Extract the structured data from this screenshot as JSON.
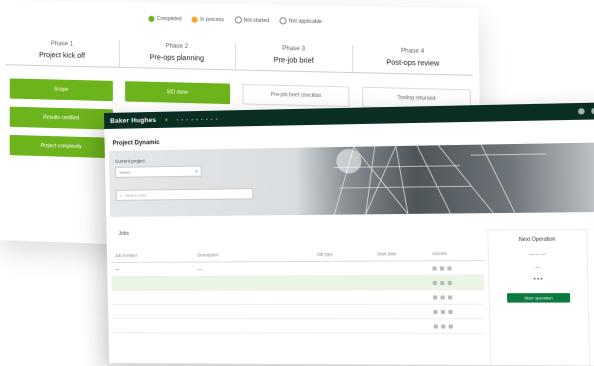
{
  "legend": {
    "completed": "Completed",
    "in_process": "In process",
    "not_started": "Not started",
    "not_applicable": "Not applicable"
  },
  "phases": [
    {
      "number": "Phase 1",
      "name": "Project kick off"
    },
    {
      "number": "Phase 2",
      "name": "Pre-ops planning"
    },
    {
      "number": "Phase 3",
      "name": "Pre-job brief"
    },
    {
      "number": "Phase 4",
      "name": "Post-ops review"
    }
  ],
  "tasks": [
    {
      "label": "Scope",
      "status": "completed"
    },
    {
      "label": "SID done",
      "status": "completed"
    },
    {
      "label": "Pre-job brief checklist",
      "status": "notstarted"
    },
    {
      "label": "Tooling returned",
      "status": "notstarted"
    },
    {
      "label": "Results certified",
      "status": "completed"
    },
    {
      "label": "",
      "status": "empty"
    },
    {
      "label": "",
      "status": "completed"
    },
    {
      "label": "",
      "status": "completed"
    },
    {
      "label": "Project complexity",
      "status": "completed"
    }
  ],
  "app": {
    "brand": "Baker Hughes",
    "page_title": "Project Dynamic",
    "hero_label": "Current project",
    "select_placeholder": "Select",
    "search_placeholder": "Search jobs",
    "jobs_title": "Jobs",
    "table_headers": [
      "Job number",
      "Description",
      "Job type",
      "Start date",
      "Actions"
    ],
    "rows": [
      {
        "c1": "—",
        "c2": "—",
        "c3": "",
        "c4": "",
        "highlight": false
      },
      {
        "c1": "",
        "c2": "",
        "c3": "",
        "c4": "",
        "highlight": true
      },
      {
        "c1": "",
        "c2": "",
        "c3": "",
        "c4": "",
        "highlight": false
      },
      {
        "c1": "",
        "c2": "",
        "c3": "",
        "c4": "",
        "highlight": false
      },
      {
        "c1": "",
        "c2": "",
        "c3": "",
        "c4": "",
        "highlight": false
      }
    ],
    "side_title": "Next Operation",
    "side_button": "Start operation"
  },
  "colors": {
    "green": "#6cb41c",
    "dark_green": "#0b2e24",
    "orange": "#f5a623"
  }
}
